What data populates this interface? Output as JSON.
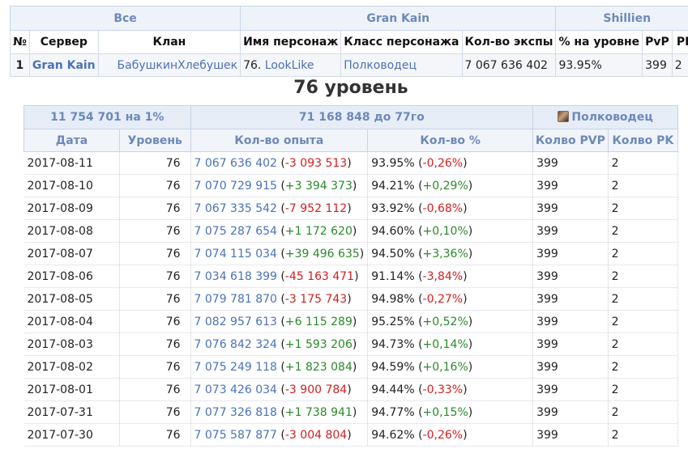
{
  "top": {
    "groups": {
      "all": "Все",
      "server": "Gran Kain",
      "shillien": "Shillien"
    },
    "headers": [
      "№",
      "Сервер",
      "Клан",
      "Имя персонаж",
      "Класс персонажа",
      "Кол-во экспы",
      "% на уровне",
      "PvP",
      "PK"
    ],
    "row": {
      "num": "1",
      "server": "Gran Kain",
      "clan": "БабушкинХлебушек",
      "name_prefix": "76.",
      "name": "LookLike",
      "class": "Полководец",
      "exp": "7 067 636 402",
      "pct": "93.95%",
      "pvp": "399",
      "pk": "2"
    }
  },
  "section_title": "76 уровень",
  "hist": {
    "group": {
      "exp_per_pct": "11 754 701 на 1%",
      "to_next": "71 168 848 до 77го",
      "class": "Полководец"
    },
    "headers": [
      "Дата",
      "Уровень",
      "Кол-во опыта",
      "Кол-во %",
      "Колво PVP",
      "Колво PK"
    ],
    "rows": [
      {
        "date": "2017-08-11",
        "level": "76",
        "exp": "7 067 636 402",
        "exp_delta": "-3 093 513",
        "pct": "93.95%",
        "pct_delta": "-0,26%",
        "pvp": "399",
        "pk": "2"
      },
      {
        "date": "2017-08-10",
        "level": "76",
        "exp": "7 070 729 915",
        "exp_delta": "+3 394 373",
        "pct": "94.21%",
        "pct_delta": "+0,29%",
        "pvp": "399",
        "pk": "2"
      },
      {
        "date": "2017-08-09",
        "level": "76",
        "exp": "7 067 335 542",
        "exp_delta": "-7 952 112",
        "pct": "93.92%",
        "pct_delta": "-0,68%",
        "pvp": "399",
        "pk": "2"
      },
      {
        "date": "2017-08-08",
        "level": "76",
        "exp": "7 075 287 654",
        "exp_delta": "+1 172 620",
        "pct": "94.60%",
        "pct_delta": "+0,10%",
        "pvp": "399",
        "pk": "2"
      },
      {
        "date": "2017-08-07",
        "level": "76",
        "exp": "7 074 115 034",
        "exp_delta": "+39 496 635",
        "pct": "94.50%",
        "pct_delta": "+3,36%",
        "pvp": "399",
        "pk": "2"
      },
      {
        "date": "2017-08-06",
        "level": "76",
        "exp": "7 034 618 399",
        "exp_delta": "-45 163 471",
        "pct": "91.14%",
        "pct_delta": "-3,84%",
        "pvp": "399",
        "pk": "2"
      },
      {
        "date": "2017-08-05",
        "level": "76",
        "exp": "7 079 781 870",
        "exp_delta": "-3 175 743",
        "pct": "94.98%",
        "pct_delta": "-0,27%",
        "pvp": "399",
        "pk": "2"
      },
      {
        "date": "2017-08-04",
        "level": "76",
        "exp": "7 082 957 613",
        "exp_delta": "+6 115 289",
        "pct": "95.25%",
        "pct_delta": "+0,52%",
        "pvp": "399",
        "pk": "2"
      },
      {
        "date": "2017-08-03",
        "level": "76",
        "exp": "7 076 842 324",
        "exp_delta": "+1 593 206",
        "pct": "94.73%",
        "pct_delta": "+0,14%",
        "pvp": "399",
        "pk": "2"
      },
      {
        "date": "2017-08-02",
        "level": "76",
        "exp": "7 075 249 118",
        "exp_delta": "+1 823 084",
        "pct": "94.59%",
        "pct_delta": "+0,16%",
        "pvp": "399",
        "pk": "2"
      },
      {
        "date": "2017-08-01",
        "level": "76",
        "exp": "7 073 426 034",
        "exp_delta": "-3 900 784",
        "pct": "94.44%",
        "pct_delta": "-0,33%",
        "pvp": "399",
        "pk": "2"
      },
      {
        "date": "2017-07-31",
        "level": "76",
        "exp": "7 077 326 818",
        "exp_delta": "+1 738 941",
        "pct": "94.77%",
        "pct_delta": "+0,15%",
        "pvp": "399",
        "pk": "2"
      },
      {
        "date": "2017-07-30",
        "level": "76",
        "exp": "7 075 587 877",
        "exp_delta": "-3 004 804",
        "pct": "94.62%",
        "pct_delta": "-0,26%",
        "pvp": "399",
        "pk": "2"
      }
    ]
  },
  "colors": {
    "link": "#4a72b8",
    "header": "#6d89b9",
    "positive": "#2a8a2a",
    "negative": "#d42020"
  },
  "icons": {
    "class_icon": "warlord-class-icon"
  }
}
